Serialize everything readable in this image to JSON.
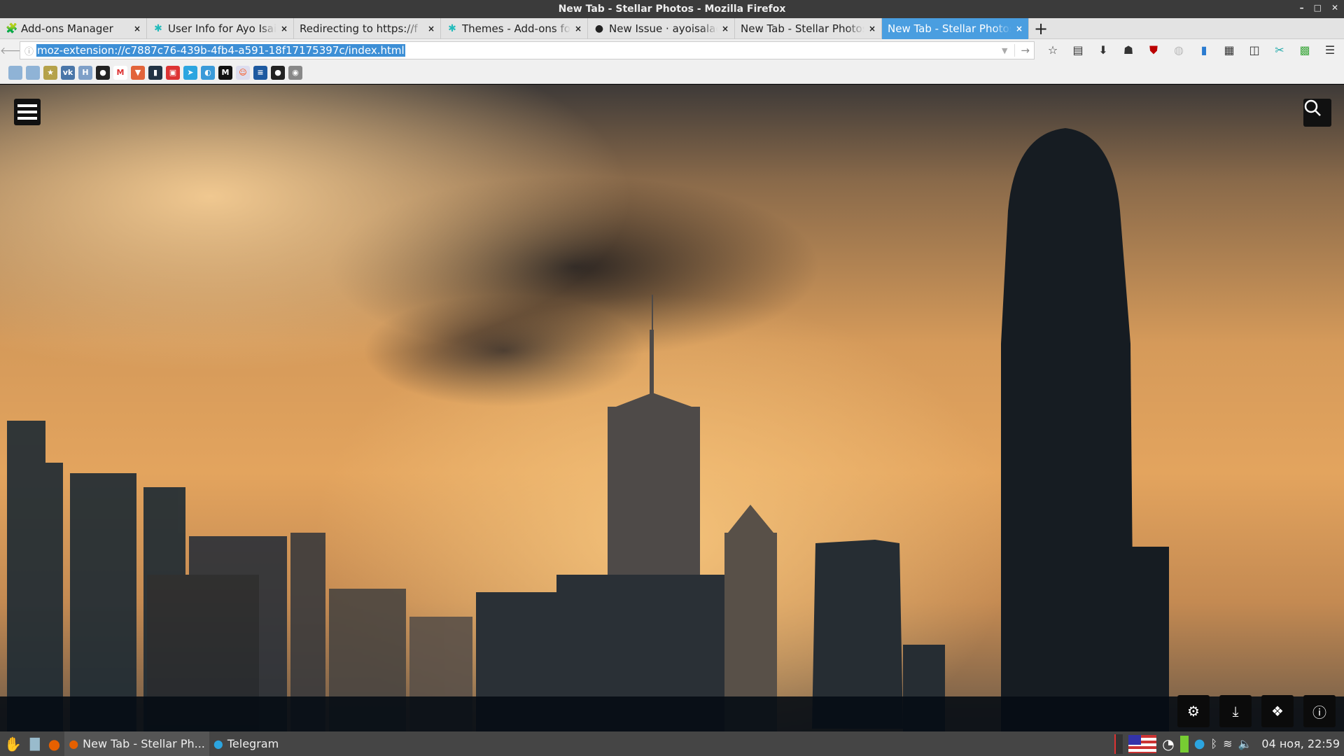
{
  "window": {
    "title": "New Tab - Stellar Photos - Mozilla Firefox",
    "controls": [
      "–",
      "□",
      "✕"
    ]
  },
  "tabs": [
    {
      "label": "Add-ons Manager",
      "icon": "puzzle-icon",
      "active": false
    },
    {
      "label": "User Info for Ayo Isaiah",
      "icon": "addons-icon",
      "active": false
    },
    {
      "label": "Redirecting to https://f",
      "icon": "",
      "active": false
    },
    {
      "label": "Themes - Add-ons for",
      "icon": "addons-icon",
      "active": false
    },
    {
      "label": "New Issue · ayoisalade",
      "icon": "github-icon",
      "active": false
    },
    {
      "label": "New Tab - Stellar Photos",
      "icon": "",
      "active": false
    },
    {
      "label": "New Tab - Stellar Photos",
      "icon": "",
      "active": true
    }
  ],
  "tab_close": "×",
  "new_tab": "+",
  "navbar": {
    "url": "moz-extension://c7887c76-439b-4fb4-a591-18f17175397c/index.html"
  },
  "toolbar_icons": [
    "star-icon",
    "clipboard-icon",
    "download-icon",
    "ghost-icon",
    "ublock-icon",
    "globe-icon",
    "extension-icon",
    "grid-icon",
    "sidebar-icon",
    "screenshot-icon",
    "s3-icon",
    "hamburger-menu-icon"
  ],
  "bookmarks": [
    {
      "icon": "folder-icon",
      "color": "#8fb3d6",
      "text": ""
    },
    {
      "icon": "folder-icon",
      "color": "#8fb3d6",
      "text": ""
    },
    {
      "icon": "star-icon",
      "color": "#b5a24a",
      "text": "★"
    },
    {
      "icon": "vk-icon",
      "color": "#4a76a8",
      "text": "vk"
    },
    {
      "icon": "h-icon",
      "color": "#7fa0c8",
      "text": "H"
    },
    {
      "icon": "github-icon",
      "color": "#222",
      "text": "●"
    },
    {
      "icon": "gmail-icon",
      "color": "#fff",
      "text": "M"
    },
    {
      "icon": "gitlab-icon",
      "color": "#e2643a",
      "text": "▼"
    },
    {
      "icon": "cup-icon",
      "color": "#234",
      "text": "▮"
    },
    {
      "icon": "tv-icon",
      "color": "#d33",
      "text": "▣"
    },
    {
      "icon": "telegram-icon",
      "color": "#2ca5e0",
      "text": "➤"
    },
    {
      "icon": "edge-icon",
      "color": "#3a9ad9",
      "text": "◐"
    },
    {
      "icon": "medium-icon",
      "color": "#111",
      "text": "M"
    },
    {
      "icon": "reddit-icon",
      "color": "#dde",
      "text": "☺"
    },
    {
      "icon": "stackoverflow-icon",
      "color": "#1e5aa0",
      "text": "≡"
    },
    {
      "icon": "github-icon",
      "color": "#222",
      "text": "●"
    },
    {
      "icon": "globe-icon",
      "color": "#888",
      "text": "◉"
    }
  ],
  "page": {
    "menu_icon": "hamburger-icon",
    "search_icon": "search-icon",
    "actions": [
      {
        "icon": "gear-icon",
        "glyph": "⚙"
      },
      {
        "icon": "download-icon",
        "glyph": "⤓"
      },
      {
        "icon": "dropbox-icon",
        "glyph": "❖"
      },
      {
        "icon": "info-icon",
        "glyph": "ⓘ"
      }
    ]
  },
  "taskbar": {
    "apps": [
      {
        "label": "New Tab - Stellar Ph...",
        "icon": "firefox-icon"
      },
      {
        "label": "Telegram",
        "icon": "telegram-icon"
      }
    ],
    "clock": "04 ноя, 22:59"
  }
}
